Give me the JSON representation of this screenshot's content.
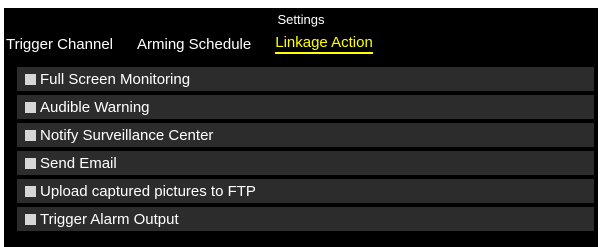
{
  "dialog": {
    "title": "Settings"
  },
  "tabs": [
    {
      "label": "Trigger Channel",
      "active": false
    },
    {
      "label": "Arming Schedule",
      "active": false
    },
    {
      "label": "Linkage Action",
      "active": true
    }
  ],
  "linkage_actions": [
    {
      "label": "Full Screen Monitoring",
      "checked": false
    },
    {
      "label": "Audible Warning",
      "checked": false
    },
    {
      "label": "Notify Surveillance Center",
      "checked": false
    },
    {
      "label": "Send Email",
      "checked": false
    },
    {
      "label": "Upload captured pictures to FTP",
      "checked": false
    },
    {
      "label": "Trigger Alarm Output",
      "checked": false
    }
  ],
  "colors": {
    "background": "#000000",
    "active_tab": "#ffff00",
    "row_background": "#2c2c2c",
    "checkbox": "#d6d6d6"
  }
}
